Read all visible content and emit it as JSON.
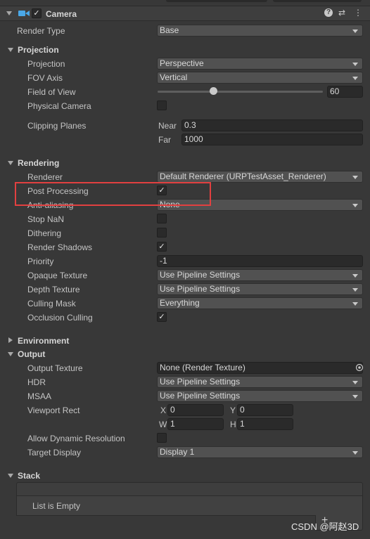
{
  "component": {
    "title": "Camera",
    "enabled_checkmark": "✓",
    "render_type_label": "Render Type",
    "render_type_value": "Base"
  },
  "projection": {
    "section_label": "Projection",
    "projection_label": "Projection",
    "projection_value": "Perspective",
    "fov_axis_label": "FOV Axis",
    "fov_axis_value": "Vertical",
    "fov_label": "Field of View",
    "fov_value": "60",
    "fov_slider_fraction": 0.34,
    "physical_camera_label": "Physical Camera",
    "clipping_label": "Clipping Planes",
    "near_label": "Near",
    "near_value": "0.3",
    "far_label": "Far",
    "far_value": "1000"
  },
  "rendering": {
    "section_label": "Rendering",
    "renderer_label": "Renderer",
    "renderer_value": "Default Renderer (URPTestAsset_Renderer)",
    "post_processing_label": "Post Processing",
    "post_processing_checked": "✓",
    "anti_aliasing_label": "Anti-aliasing",
    "anti_aliasing_value": "None",
    "stop_nan_label": "Stop NaN",
    "dithering_label": "Dithering",
    "render_shadows_label": "Render Shadows",
    "render_shadows_checked": "✓",
    "priority_label": "Priority",
    "priority_value": "-1",
    "opaque_texture_label": "Opaque Texture",
    "opaque_texture_value": "Use Pipeline Settings",
    "depth_texture_label": "Depth Texture",
    "depth_texture_value": "Use Pipeline Settings",
    "culling_mask_label": "Culling Mask",
    "culling_mask_value": "Everything",
    "occlusion_culling_label": "Occlusion Culling",
    "occlusion_culling_checked": "✓"
  },
  "environment": {
    "section_label": "Environment"
  },
  "output": {
    "section_label": "Output",
    "output_texture_label": "Output Texture",
    "output_texture_value": "None (Render Texture)",
    "hdr_label": "HDR",
    "hdr_value": "Use Pipeline Settings",
    "msaa_label": "MSAA",
    "msaa_value": "Use Pipeline Settings",
    "viewport_label": "Viewport Rect",
    "x_label": "X",
    "x_value": "0",
    "y_label": "Y",
    "y_value": "0",
    "w_label": "W",
    "w_value": "1",
    "h_label": "H",
    "h_value": "1",
    "dynamic_res_label": "Allow Dynamic Resolution",
    "target_display_label": "Target Display",
    "target_display_value": "Display 1"
  },
  "stack": {
    "section_label": "Stack",
    "empty_text": "List is Empty",
    "add_icon": "+"
  },
  "watermark": "CSDN @阿赵3D",
  "icons": {
    "help": "?",
    "presets": "⇄",
    "more": "⋮"
  },
  "colors": {
    "background": "#383838",
    "highlight": "#e24040",
    "camera_icon": "#4aa8e8"
  }
}
